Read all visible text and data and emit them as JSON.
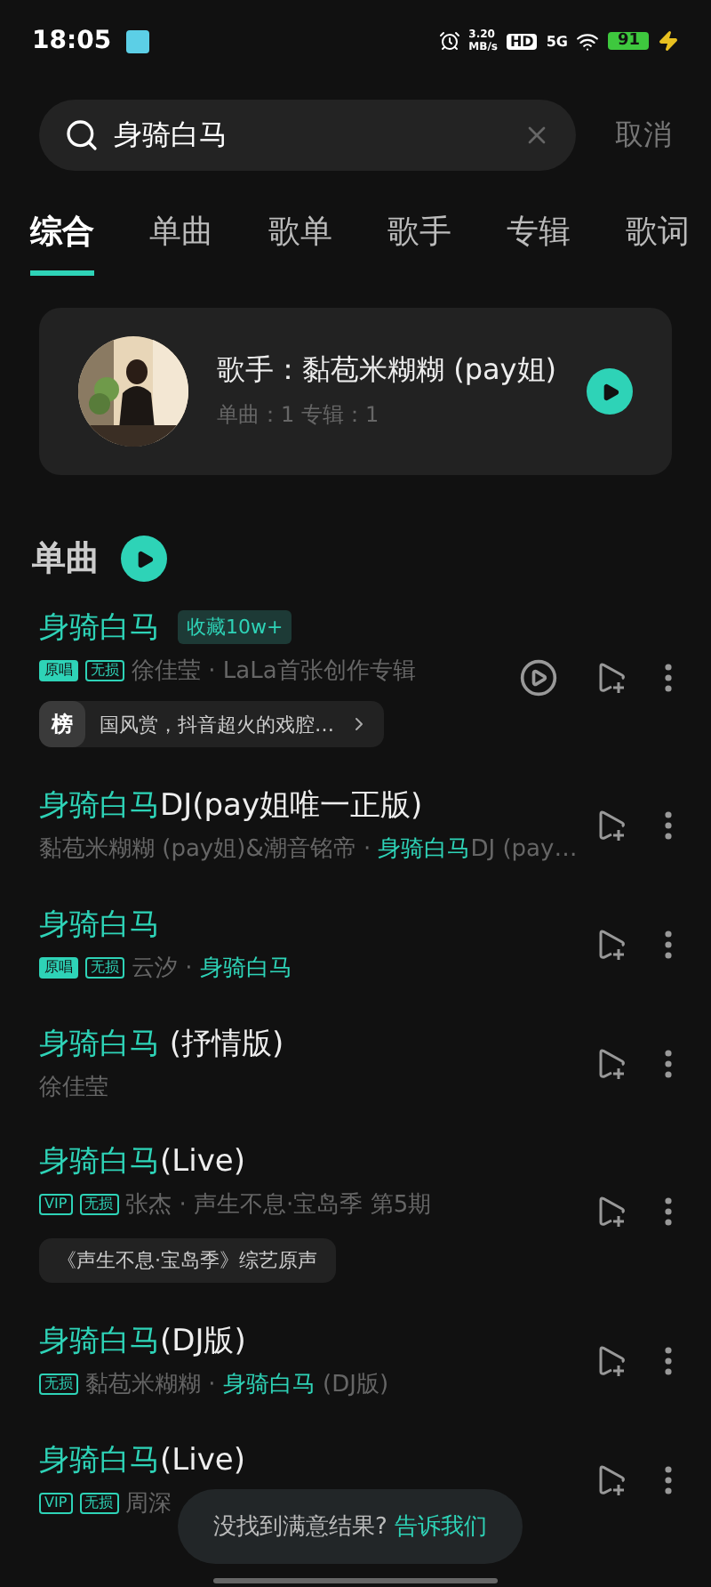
{
  "status_bar": {
    "time": "18:05",
    "speed": "3.20",
    "speed_unit": "MB/s",
    "hd": "HD",
    "network": "5G",
    "battery": "91"
  },
  "search": {
    "value": "身骑白马",
    "cancel": "取消"
  },
  "tabs": [
    {
      "label": "综合",
      "selected": true
    },
    {
      "label": "单曲",
      "selected": false
    },
    {
      "label": "歌单",
      "selected": false
    },
    {
      "label": "歌手",
      "selected": false
    },
    {
      "label": "专辑",
      "selected": false
    },
    {
      "label": "歌词",
      "selected": false
    }
  ],
  "artist_card": {
    "name": "歌手：黏苞米糊糊 (pay姐)",
    "stats": "单曲：1 专辑：1"
  },
  "songs_section": {
    "title": "单曲"
  },
  "songs": [
    {
      "title": [
        {
          "text": "身骑白马",
          "highlight": true
        }
      ],
      "badge": "收藏10w+",
      "tags": [
        {
          "kind": "original",
          "text": "原唱"
        },
        {
          "kind": "lossless",
          "text": "无损"
        }
      ],
      "meta": [
        {
          "text": "徐佳莹 · LaLa首张创作专辑",
          "highlight": false
        }
      ],
      "mv": true,
      "chart_chip": {
        "mark": "榜",
        "text": "国风赏，抖音超火的戏腔…"
      }
    },
    {
      "title": [
        {
          "text": "身骑白马",
          "highlight": true
        },
        {
          "text": "DJ(pay姐唯一正版)",
          "highlight": false
        }
      ],
      "meta": [
        {
          "text": "黏苞米糊糊 (pay姐)&潮音铭帝 · ",
          "highlight": false
        },
        {
          "text": "身骑白马",
          "highlight": true
        },
        {
          "text": "DJ (pay…",
          "highlight": false
        }
      ],
      "mv": false
    },
    {
      "title": [
        {
          "text": "身骑白马",
          "highlight": true
        }
      ],
      "tags": [
        {
          "kind": "original",
          "text": "原唱"
        },
        {
          "kind": "lossless",
          "text": "无损"
        }
      ],
      "meta": [
        {
          "text": "云汐 · ",
          "highlight": false
        },
        {
          "text": "身骑白马",
          "highlight": true
        }
      ],
      "mv": false
    },
    {
      "title": [
        {
          "text": "身骑白马",
          "highlight": true
        },
        {
          "text": " (抒情版)",
          "highlight": false
        }
      ],
      "meta": [
        {
          "text": "徐佳莹",
          "highlight": false
        }
      ],
      "mv": false
    },
    {
      "title": [
        {
          "text": "身骑白马",
          "highlight": true
        },
        {
          "text": "(Live)",
          "highlight": false
        }
      ],
      "tags": [
        {
          "kind": "vip",
          "text": "VIP"
        },
        {
          "kind": "lossless",
          "text": "无损"
        }
      ],
      "meta": [
        {
          "text": "张杰 · 声生不息·宝岛季 第5期",
          "highlight": false
        }
      ],
      "mv": false,
      "note_chip": "《声生不息·宝岛季》综艺原声"
    },
    {
      "title": [
        {
          "text": "身骑白马",
          "highlight": true
        },
        {
          "text": "(DJ版)",
          "highlight": false
        }
      ],
      "tags": [
        {
          "kind": "lossless",
          "text": "无损"
        }
      ],
      "meta": [
        {
          "text": "黏苞米糊糊 · ",
          "highlight": false
        },
        {
          "text": "身骑白马",
          "highlight": true
        },
        {
          "text": " (DJ版)",
          "highlight": false
        }
      ],
      "mv": false
    },
    {
      "title": [
        {
          "text": "身骑白马",
          "highlight": true
        },
        {
          "text": "(Live)",
          "highlight": false
        }
      ],
      "tags": [
        {
          "kind": "vip",
          "text": "VIP"
        },
        {
          "kind": "lossless",
          "text": "无损"
        }
      ],
      "meta": [
        {
          "text": "周深",
          "highlight": false
        }
      ],
      "mv": false
    }
  ],
  "toast": {
    "text": "没找到满意结果?",
    "link": "告诉我们"
  }
}
